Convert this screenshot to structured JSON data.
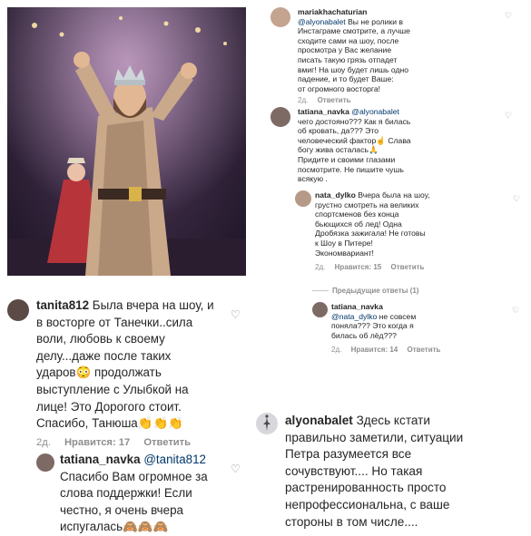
{
  "photo": {
    "alt": "stage performer photo"
  },
  "c1": {
    "username": "mariakhachaturian",
    "mention": "@alyonabalet",
    "lines": [
      " Вы не ролики в",
      "Инстаграме смотрите, а лучше",
      "сходите сами на шоу, после",
      "просмотра у Вас желание",
      "писать такую грязь отпадет",
      "вмиг! На шоу будет лишь одно",
      "падение, и то будет Ваше:",
      "от огромного восторга!"
    ],
    "time": "2д.",
    "reply": "Ответить"
  },
  "c2": {
    "username": "tatiana_navka",
    "mention": "@alyonabalet",
    "lines": [
      "чего достояно??? Как я билась",
      "об кровать, да??? Это",
      "человеческий фактор",
      "богу жива осталась",
      "Придите и своими глазами",
      "посмотрите. Не пишите чушь",
      "всякую ."
    ],
    "line3_tail": " Слава",
    "time": "2д.",
    "reply": "Ответить"
  },
  "c3": {
    "username": "nata_dylko",
    "lines": [
      " Вчера была на шоу,",
      "грустно смотреть на великих",
      "спортсменов без конца",
      "бьющихся об лед! Одна",
      "Дробязка зажигала! Не готовы",
      "к Шоу в Питере!",
      "Экономвариант!"
    ],
    "time": "2д.",
    "likes": "Нравится: 15",
    "reply": "Ответить",
    "prev_replies": "Предыдущие ответы (1)"
  },
  "c4": {
    "username": "tatiana_navka",
    "mention": "@nata_dylko",
    "lines": [
      " не совсем",
      "поняла??? Это когда я",
      "билась об лёд???"
    ],
    "time": "2д.",
    "likes": "Нравится: 14",
    "reply": "Ответить"
  },
  "c5": {
    "username": "tanita812",
    "lines": [
      " Была вчера на шоу, и",
      "в восторге от Танечки..сила",
      "воли, любовь к своему",
      "делу...даже после таких",
      "ударов",
      " продолжать",
      "выступление с Улыбкой на",
      "лице! Это Дорогого стоит.",
      "Спасибо, Танюша"
    ],
    "time": "2д.",
    "likes": "Нравится: 17",
    "reply": "Ответить"
  },
  "c6": {
    "username": "tatiana_navka",
    "mention": "@tanita812",
    "lines": [
      "Спасибо Вам огромное за",
      "слова поддержки! Если",
      "честно, я очень вчера",
      "испугалась"
    ]
  },
  "c7": {
    "username": "alyonabalet",
    "lines": [
      " Здесь кстати",
      "правильно заметили, ситуации",
      "Петра разумеется все",
      "сочувствуют.... Но такая",
      "растренированность просто",
      "непрофессиональна, с ваше",
      "стороны в том числе...."
    ]
  },
  "colors": {
    "link": "#00376b",
    "meta": "#8e8e8e",
    "text": "#262626"
  }
}
